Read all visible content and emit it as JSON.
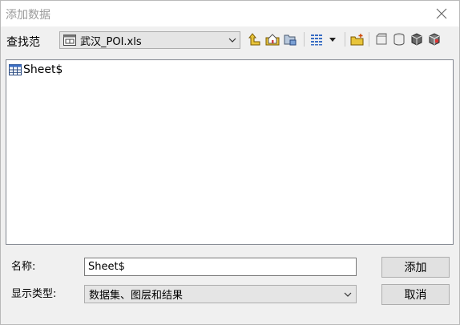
{
  "window": {
    "title": "添加数据"
  },
  "lookin": {
    "label": "查找范",
    "value": "武汉_POI.xls"
  },
  "toolbar": [
    "up-one-level-icon",
    "home-folder-icon",
    "connect-folder-icon",
    "view-options-icon",
    "new-folder-icon",
    "new-database-icon",
    "new-geodatabase-icon",
    "new-feature-class-icon",
    "toolbox-icon"
  ],
  "filelist": {
    "items": [
      {
        "label": "Sheet$",
        "icon": "table-icon"
      }
    ]
  },
  "name": {
    "label": "名称:",
    "value": "Sheet$"
  },
  "type": {
    "label": "显示类型:",
    "value": "数据集、图层和结果"
  },
  "buttons": {
    "add": "添加",
    "cancel": "取消"
  }
}
